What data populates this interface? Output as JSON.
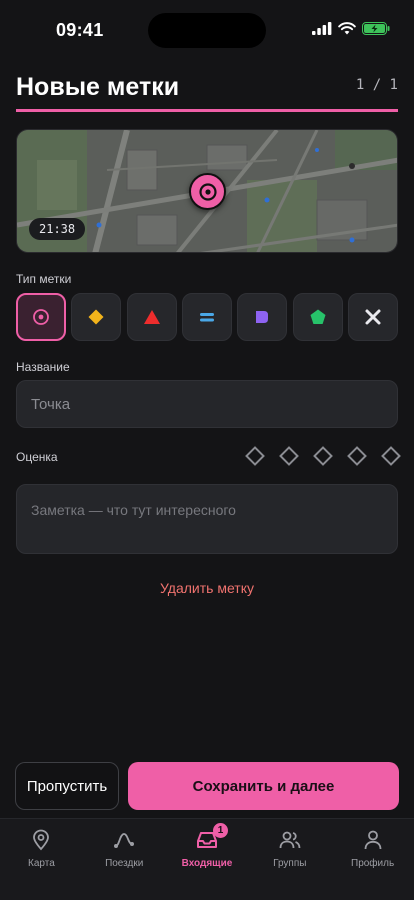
{
  "status": {
    "time": "09:41"
  },
  "header": {
    "title": "Новые метки",
    "counter": "1 / 1"
  },
  "map": {
    "time": "21:38"
  },
  "types": {
    "label": "Тип метки",
    "items": [
      {
        "icon": "target-icon",
        "color": "#ef5fa7",
        "active": true
      },
      {
        "icon": "diamond-icon",
        "color": "#f2b31b"
      },
      {
        "icon": "triangle-icon",
        "color": "#ee2d2d"
      },
      {
        "icon": "equals-icon",
        "color": "#4aa8e8"
      },
      {
        "icon": "flag-icon",
        "color": "#8e63f2"
      },
      {
        "icon": "pentagon-icon",
        "color": "#27c26a"
      },
      {
        "icon": "close-icon",
        "color": "#e9e9ee"
      }
    ]
  },
  "name_field": {
    "label": "Название",
    "placeholder": "Точка"
  },
  "rating": {
    "label": "Оценка",
    "max": 5,
    "value": 0
  },
  "note_field": {
    "placeholder": "Заметка — что тут интересного"
  },
  "delete_label": "Удалить метку",
  "actions": {
    "skip_label": "Пропустить",
    "save_label": "Сохранить и далее"
  },
  "tabbar": {
    "items": [
      {
        "label": "Карта",
        "icon": "map-pin-icon"
      },
      {
        "label": "Поездки",
        "icon": "route-icon"
      },
      {
        "label": "Входящие",
        "icon": "inbox-icon",
        "badge": "1",
        "active": true
      },
      {
        "label": "Группы",
        "icon": "users-icon"
      },
      {
        "label": "Профиль",
        "icon": "user-icon"
      }
    ]
  },
  "colors": {
    "accent": "#ef5fa7",
    "danger": "#f0736f",
    "background": "#141416"
  }
}
